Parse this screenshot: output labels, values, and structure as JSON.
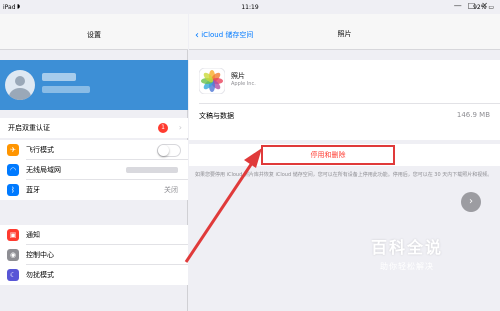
{
  "status_bar": {
    "device": "iPad",
    "time": "11:19",
    "battery": "92%"
  },
  "window_controls": {
    "minimize": "—",
    "maximize": "□",
    "close": "✕"
  },
  "sidebar": {
    "title": "设置",
    "two_factor": {
      "label": "开启双重认证",
      "badge": "1"
    },
    "items": [
      {
        "label": "飞行模式",
        "icon": "airplane-icon",
        "color": "#ff9500"
      },
      {
        "label": "无线局域网",
        "icon": "wifi-icon",
        "color": "#007aff"
      },
      {
        "label": "蓝牙",
        "icon": "bluetooth-icon",
        "color": "#007aff",
        "value": "关闭"
      },
      {
        "label": "通知",
        "icon": "notification-icon",
        "color": "#ff3b30"
      },
      {
        "label": "控制中心",
        "icon": "control-center-icon",
        "color": "#8e8e93"
      },
      {
        "label": "勿扰模式",
        "icon": "moon-icon",
        "color": "#5856d6"
      }
    ]
  },
  "detail": {
    "back_label": "iCloud 储存空间",
    "title": "照片",
    "app": {
      "name": "照片",
      "developer": "Apple Inc."
    },
    "docs_label": "文稿与数据",
    "docs_value": "146.9 MB",
    "delete_button": "停用和删除",
    "footnote": "如果您要停用 iCloud 照片库并恢复 iCloud 储存空间，您可以在所有设备上停用此功能。停用后，您可以在 30 天内下载照片和视频。"
  },
  "watermark": {
    "line1": "百科全说",
    "line2": "助你轻松解决"
  }
}
